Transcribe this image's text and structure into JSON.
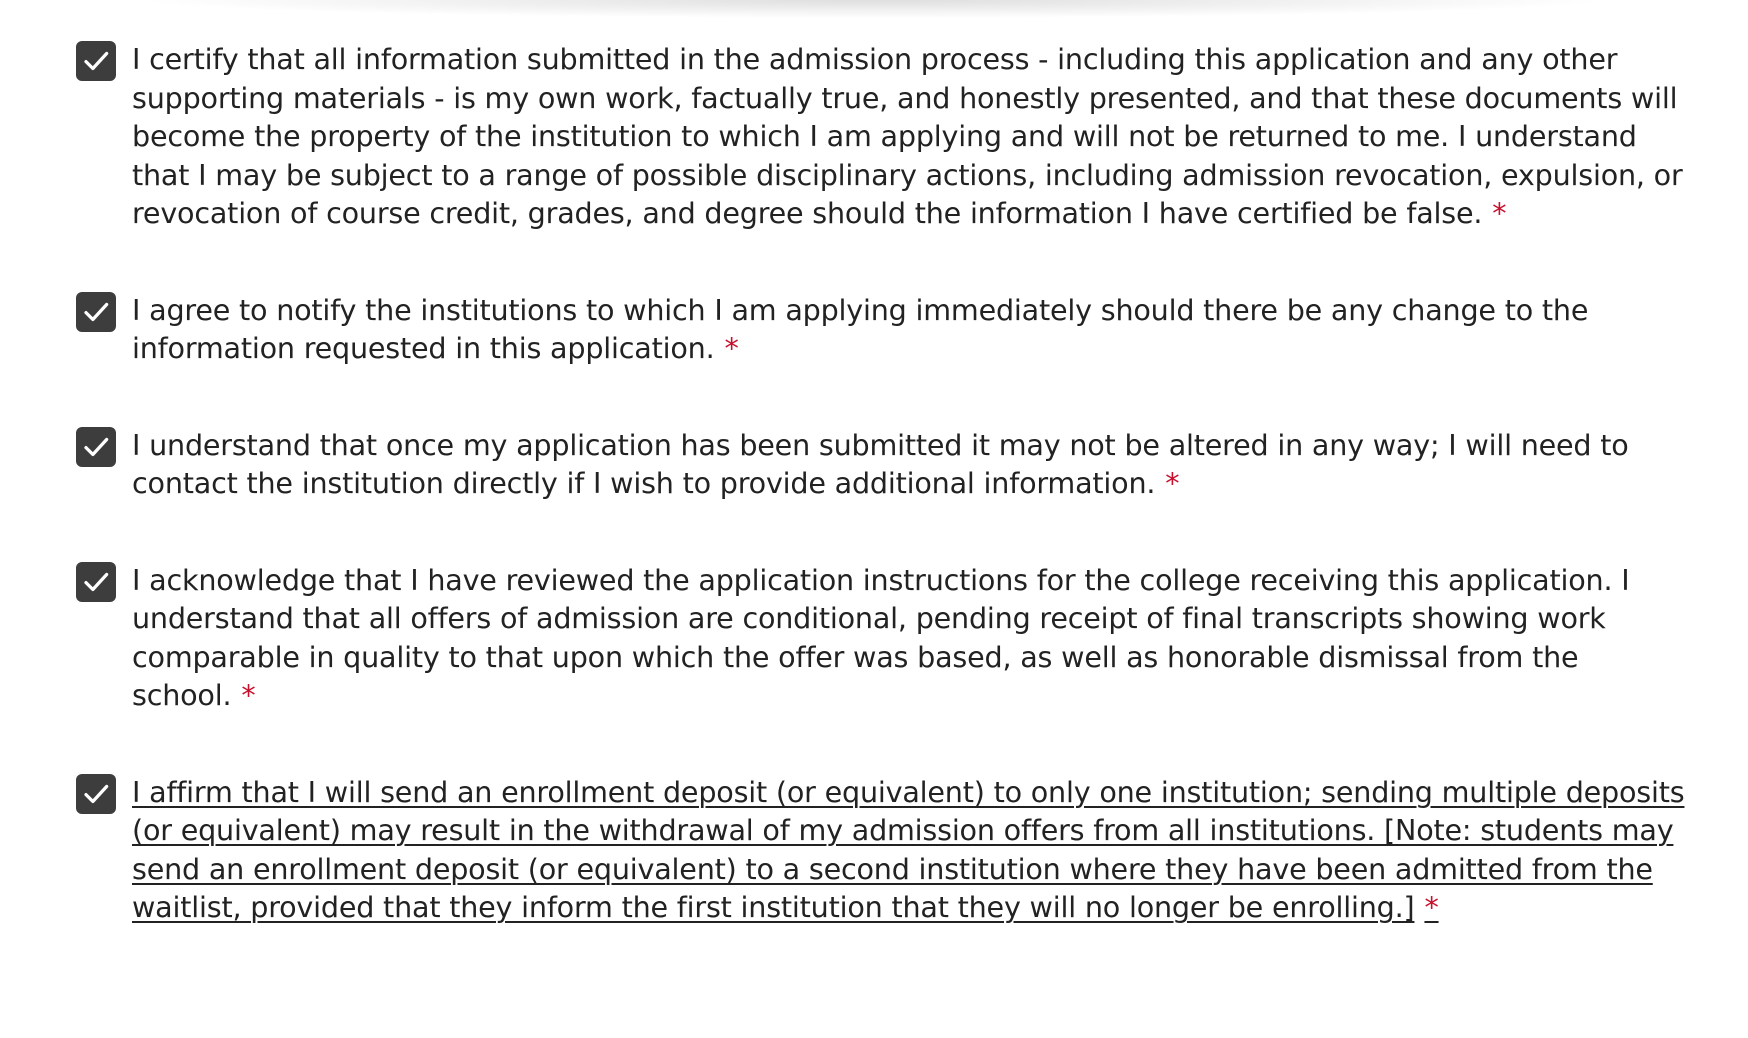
{
  "form": {
    "required_marker": "*",
    "items": [
      {
        "checked": true,
        "text": "I certify that all information submitted in the admission process - including this application and any other supporting materials - is my own work, factually true, and honestly presented, and that these documents will become the property of the institution to which I am applying and will not be returned to me. I understand that I may be subject to a range of possible disciplinary actions, including admission revocation, expulsion, or revocation of course credit, grades, and degree should the information I have certified be false."
      },
      {
        "checked": true,
        "text": "I agree to notify the institutions to which I am applying immediately should there be any change to the information requested in this application."
      },
      {
        "checked": true,
        "text": "I understand that once my application has been submitted it may not be altered in any way; I will need to contact the institution directly if I wish to provide additional information."
      },
      {
        "checked": true,
        "text": "I acknowledge that I have reviewed the application instructions for the college receiving this application. I understand that all offers of admission are conditional, pending receipt of final transcripts showing work comparable in quality to that upon which the offer was based, as well as honorable dismissal from the school."
      },
      {
        "checked": true,
        "text": "I affirm that I will send an enrollment deposit (or equivalent) to only one institution; sending multiple deposits (or equivalent) may result in the withdrawal of my admission offers from all institutions. [Note: students may send an enrollment deposit (or equivalent) to a second institution where they have been admitted from the waitlist, provided that they inform the first institution that they will no longer be enrolling.]"
      }
    ]
  },
  "colors": {
    "checkbox_fill": "#3d3d3d",
    "checkmark": "#ffffff",
    "text": "#222222",
    "required": "#c8102e"
  },
  "icons": {
    "checkbox": "checkmark-icon"
  }
}
